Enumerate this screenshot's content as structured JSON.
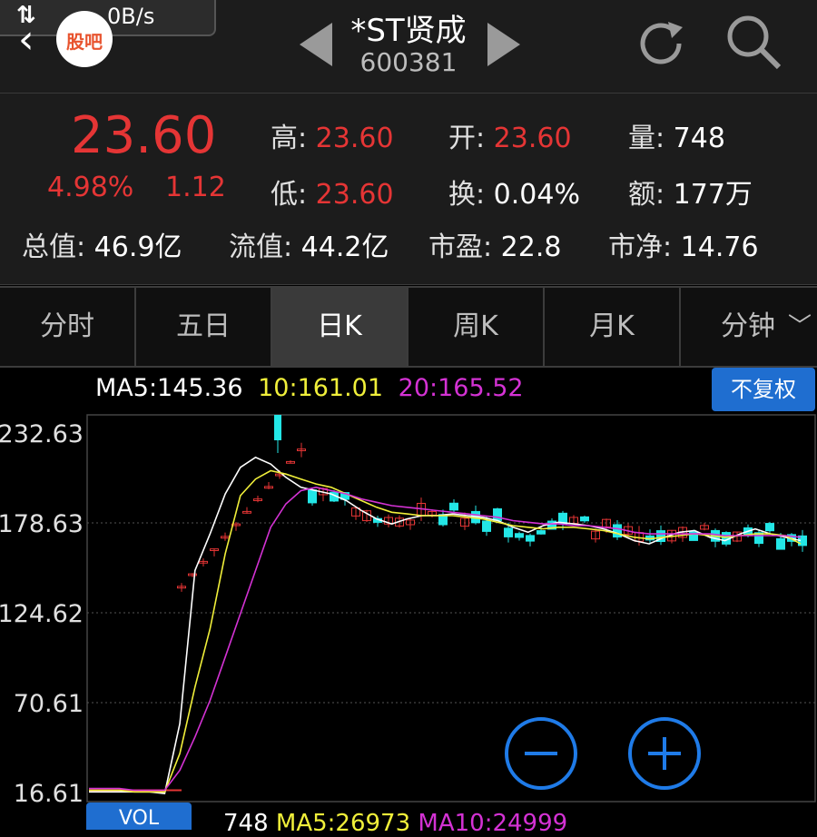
{
  "status": {
    "net_speed": "0B/s",
    "net_icon": "up-down-arrows-icon"
  },
  "header": {
    "back_icon": "chevron-left-icon",
    "guba_label": "股吧",
    "stock_name": "*ST贤成",
    "stock_code": "600381"
  },
  "quote": {
    "price": "23.60",
    "change_pct": "4.98%",
    "change": "1.12",
    "high_label": "高:",
    "high": "23.60",
    "low_label": "低:",
    "low": "23.60",
    "open_label": "开:",
    "open": "23.60",
    "turnover_label": "换:",
    "turnover": "0.04%",
    "volume_label": "量:",
    "volume": "748",
    "amount_label": "额:",
    "amount": "177万",
    "total_mv_label": "总值:",
    "total_mv": "46.9亿",
    "float_mv_label": "流值:",
    "float_mv": "44.2亿",
    "pe_label": "市盈:",
    "pe": "22.8",
    "pb_label": "市净:",
    "pb": "14.76"
  },
  "tabs": [
    "分时",
    "五日",
    "日K",
    "周K",
    "月K",
    "分钟"
  ],
  "active_tab": "日K",
  "ma": {
    "ma5": "MA5:145.36",
    "ma10": "10:161.01",
    "ma20": "20:165.52"
  },
  "adjust_button": "不复权",
  "colors": {
    "up": "#e53535",
    "down": "#23e6e6",
    "ma5": "#ffffff",
    "ma10": "#f0ef3a",
    "ma20": "#d432d4",
    "button": "#1f6ed0"
  },
  "vol": {
    "tab_label": "VOL",
    "value": "748",
    "ma5": "MA5:26973",
    "ma10": "MA10:24999"
  },
  "chart_data": {
    "type": "candlestick",
    "y_ticks": [
      "232.63",
      "178.63",
      "124.62",
      "70.61",
      "16.61"
    ],
    "ylim": [
      16.61,
      232.63
    ],
    "grid": true,
    "series": [
      {
        "name": "MA5",
        "color": "#ffffff",
        "values": [
          17,
          17,
          17,
          17,
          17,
          16,
          58,
          150,
          172,
          196,
          212,
          218,
          214,
          206,
          200,
          198,
          196,
          192,
          186,
          181,
          178,
          181,
          183,
          183,
          184,
          183,
          182,
          180,
          176,
          173,
          177,
          179,
          178,
          177,
          175,
          172,
          168,
          166,
          170,
          173,
          174,
          170,
          168,
          172,
          175,
          172,
          170,
          168
        ]
      },
      {
        "name": "MA10",
        "color": "#f0ef3a",
        "values": [
          18,
          18,
          18,
          17,
          17,
          17,
          40,
          80,
          115,
          160,
          195,
          205,
          210,
          208,
          205,
          202,
          200,
          196,
          192,
          188,
          185,
          184,
          183,
          183,
          183,
          182,
          181,
          179,
          177,
          176,
          175,
          176,
          176,
          175,
          174,
          172,
          170,
          169,
          170,
          171,
          172,
          171,
          170,
          171,
          172,
          172,
          171,
          166
        ]
      },
      {
        "name": "MA20",
        "color": "#d432d4",
        "values": [
          19,
          19,
          19,
          18,
          18,
          18,
          30,
          50,
          72,
          98,
          124,
          150,
          176,
          190,
          198,
          200,
          198,
          196,
          193,
          191,
          189,
          188,
          187,
          186,
          185,
          184,
          183,
          182,
          180,
          179,
          178,
          178,
          177,
          177,
          176,
          175,
          173,
          172,
          172,
          172,
          172,
          172,
          171,
          171,
          171,
          171,
          171,
          170
        ]
      }
    ],
    "candles_note": "daily OHLC candles; red = up (hollow), cyan = down (filled)"
  }
}
